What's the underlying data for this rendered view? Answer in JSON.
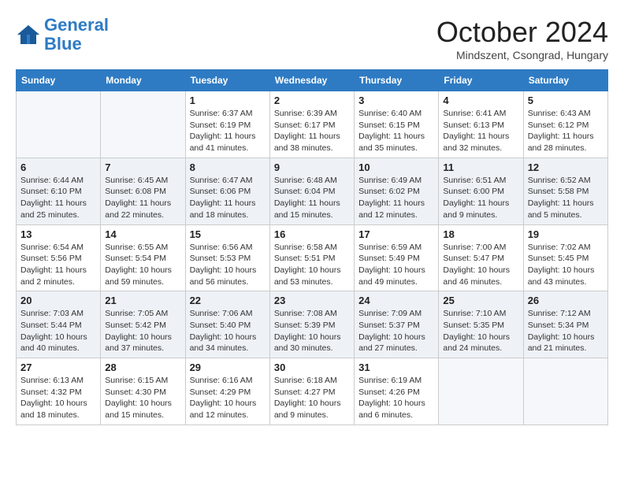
{
  "header": {
    "logo_line1": "General",
    "logo_line2": "Blue",
    "month_title": "October 2024",
    "location": "Mindszent, Csongrad, Hungary"
  },
  "weekdays": [
    "Sunday",
    "Monday",
    "Tuesday",
    "Wednesday",
    "Thursday",
    "Friday",
    "Saturday"
  ],
  "weeks": [
    [
      {
        "day": "",
        "info": ""
      },
      {
        "day": "",
        "info": ""
      },
      {
        "day": "1",
        "info": "Sunrise: 6:37 AM\nSunset: 6:19 PM\nDaylight: 11 hours and 41 minutes."
      },
      {
        "day": "2",
        "info": "Sunrise: 6:39 AM\nSunset: 6:17 PM\nDaylight: 11 hours and 38 minutes."
      },
      {
        "day": "3",
        "info": "Sunrise: 6:40 AM\nSunset: 6:15 PM\nDaylight: 11 hours and 35 minutes."
      },
      {
        "day": "4",
        "info": "Sunrise: 6:41 AM\nSunset: 6:13 PM\nDaylight: 11 hours and 32 minutes."
      },
      {
        "day": "5",
        "info": "Sunrise: 6:43 AM\nSunset: 6:12 PM\nDaylight: 11 hours and 28 minutes."
      }
    ],
    [
      {
        "day": "6",
        "info": "Sunrise: 6:44 AM\nSunset: 6:10 PM\nDaylight: 11 hours and 25 minutes."
      },
      {
        "day": "7",
        "info": "Sunrise: 6:45 AM\nSunset: 6:08 PM\nDaylight: 11 hours and 22 minutes."
      },
      {
        "day": "8",
        "info": "Sunrise: 6:47 AM\nSunset: 6:06 PM\nDaylight: 11 hours and 18 minutes."
      },
      {
        "day": "9",
        "info": "Sunrise: 6:48 AM\nSunset: 6:04 PM\nDaylight: 11 hours and 15 minutes."
      },
      {
        "day": "10",
        "info": "Sunrise: 6:49 AM\nSunset: 6:02 PM\nDaylight: 11 hours and 12 minutes."
      },
      {
        "day": "11",
        "info": "Sunrise: 6:51 AM\nSunset: 6:00 PM\nDaylight: 11 hours and 9 minutes."
      },
      {
        "day": "12",
        "info": "Sunrise: 6:52 AM\nSunset: 5:58 PM\nDaylight: 11 hours and 5 minutes."
      }
    ],
    [
      {
        "day": "13",
        "info": "Sunrise: 6:54 AM\nSunset: 5:56 PM\nDaylight: 11 hours and 2 minutes."
      },
      {
        "day": "14",
        "info": "Sunrise: 6:55 AM\nSunset: 5:54 PM\nDaylight: 10 hours and 59 minutes."
      },
      {
        "day": "15",
        "info": "Sunrise: 6:56 AM\nSunset: 5:53 PM\nDaylight: 10 hours and 56 minutes."
      },
      {
        "day": "16",
        "info": "Sunrise: 6:58 AM\nSunset: 5:51 PM\nDaylight: 10 hours and 53 minutes."
      },
      {
        "day": "17",
        "info": "Sunrise: 6:59 AM\nSunset: 5:49 PM\nDaylight: 10 hours and 49 minutes."
      },
      {
        "day": "18",
        "info": "Sunrise: 7:00 AM\nSunset: 5:47 PM\nDaylight: 10 hours and 46 minutes."
      },
      {
        "day": "19",
        "info": "Sunrise: 7:02 AM\nSunset: 5:45 PM\nDaylight: 10 hours and 43 minutes."
      }
    ],
    [
      {
        "day": "20",
        "info": "Sunrise: 7:03 AM\nSunset: 5:44 PM\nDaylight: 10 hours and 40 minutes."
      },
      {
        "day": "21",
        "info": "Sunrise: 7:05 AM\nSunset: 5:42 PM\nDaylight: 10 hours and 37 minutes."
      },
      {
        "day": "22",
        "info": "Sunrise: 7:06 AM\nSunset: 5:40 PM\nDaylight: 10 hours and 34 minutes."
      },
      {
        "day": "23",
        "info": "Sunrise: 7:08 AM\nSunset: 5:39 PM\nDaylight: 10 hours and 30 minutes."
      },
      {
        "day": "24",
        "info": "Sunrise: 7:09 AM\nSunset: 5:37 PM\nDaylight: 10 hours and 27 minutes."
      },
      {
        "day": "25",
        "info": "Sunrise: 7:10 AM\nSunset: 5:35 PM\nDaylight: 10 hours and 24 minutes."
      },
      {
        "day": "26",
        "info": "Sunrise: 7:12 AM\nSunset: 5:34 PM\nDaylight: 10 hours and 21 minutes."
      }
    ],
    [
      {
        "day": "27",
        "info": "Sunrise: 6:13 AM\nSunset: 4:32 PM\nDaylight: 10 hours and 18 minutes."
      },
      {
        "day": "28",
        "info": "Sunrise: 6:15 AM\nSunset: 4:30 PM\nDaylight: 10 hours and 15 minutes."
      },
      {
        "day": "29",
        "info": "Sunrise: 6:16 AM\nSunset: 4:29 PM\nDaylight: 10 hours and 12 minutes."
      },
      {
        "day": "30",
        "info": "Sunrise: 6:18 AM\nSunset: 4:27 PM\nDaylight: 10 hours and 9 minutes."
      },
      {
        "day": "31",
        "info": "Sunrise: 6:19 AM\nSunset: 4:26 PM\nDaylight: 10 hours and 6 minutes."
      },
      {
        "day": "",
        "info": ""
      },
      {
        "day": "",
        "info": ""
      }
    ]
  ]
}
